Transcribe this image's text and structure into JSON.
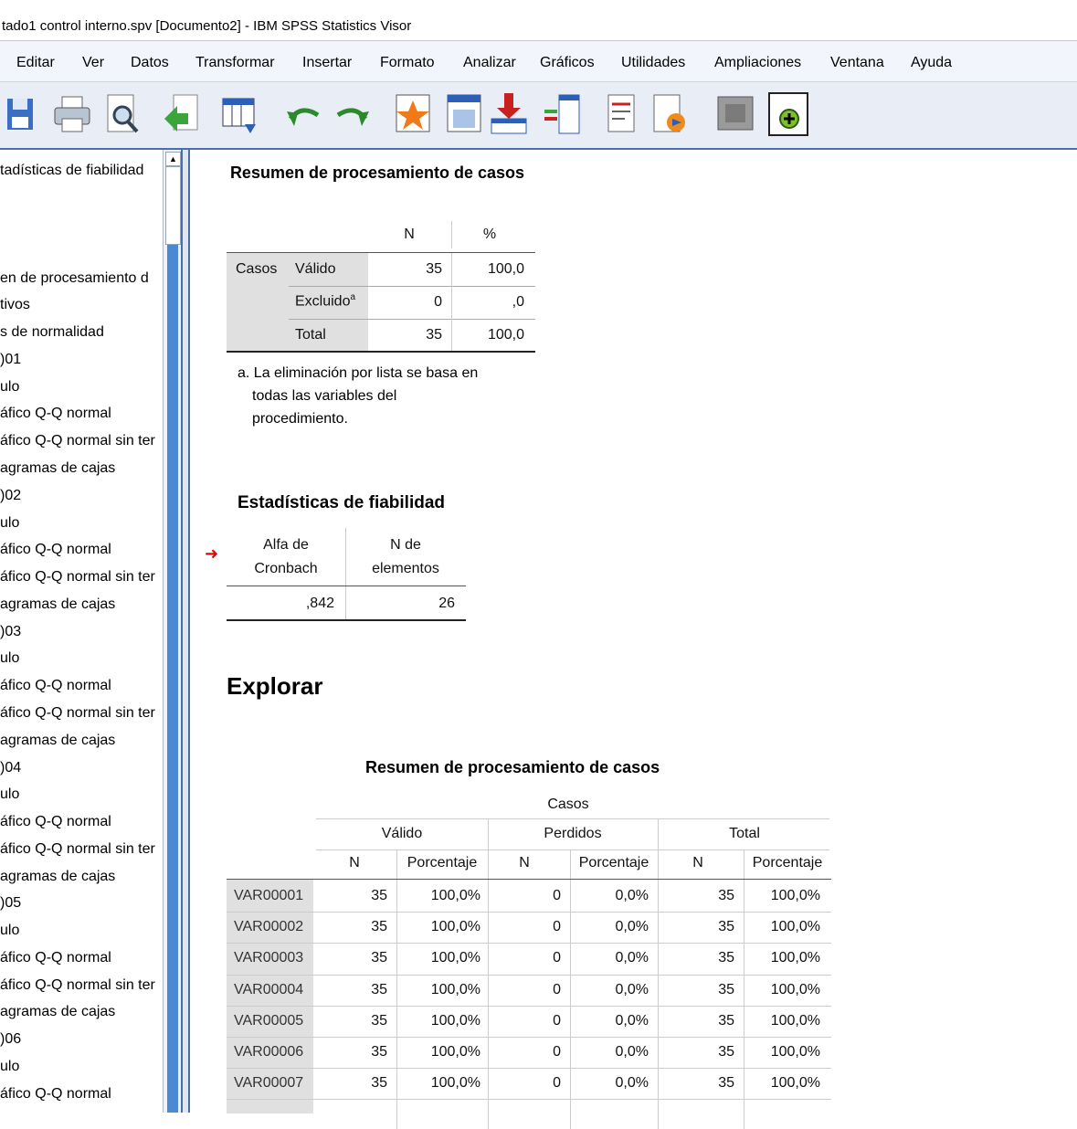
{
  "window": {
    "title": "tado1 control interno.spv [Documento2] - IBM SPSS Statistics Visor"
  },
  "menu": [
    "Editar",
    "Ver",
    "Datos",
    "Transformar",
    "Insertar",
    "Formato",
    "Analizar",
    "Gráficos",
    "Utilidades",
    "Ampliaciones",
    "Ventana",
    "Ayuda"
  ],
  "toolbar_icons": [
    "save-icon",
    "print-icon",
    "print-preview-icon",
    "export-icon",
    "goto-data-icon",
    "undo-icon",
    "redo-icon",
    "goto-case-icon",
    "goto-variable-icon",
    "insert-output-icon",
    "insert-table-icon",
    "insert-text-icon",
    "insert-chart-icon",
    "promote-icon",
    "designate-window-icon"
  ],
  "nav": [
    "tadísticas de fiabilidad",
    "en de procesamiento d",
    "tivos",
    "s de normalidad",
    ")01",
    "ulo",
    "áfico Q-Q normal",
    "áfico Q-Q normal sin ter",
    "agramas de cajas",
    ")02",
    "ulo",
    "áfico Q-Q normal",
    "áfico Q-Q normal sin ter",
    "agramas de cajas",
    ")03",
    "ulo",
    "áfico Q-Q normal",
    "áfico Q-Q normal sin ter",
    "agramas de cajas",
    ")04",
    "ulo",
    "áfico Q-Q normal",
    "áfico Q-Q normal sin ter",
    "agramas de cajas",
    ")05",
    "ulo",
    "áfico Q-Q normal",
    "áfico Q-Q normal sin ter",
    "agramas de cajas",
    ")06",
    "ulo",
    "áfico Q-Q normal"
  ],
  "case_summary": {
    "title": "Resumen de procesamiento de casos",
    "headers": [
      "N",
      "%"
    ],
    "group": "Casos",
    "rows": [
      {
        "label": "Válido",
        "n": "35",
        "pct": "100,0"
      },
      {
        "label": "Excluido",
        "sup": "a",
        "n": "0",
        "pct": ",0"
      },
      {
        "label": "Total",
        "n": "35",
        "pct": "100,0"
      }
    ],
    "footnote": [
      "a. La eliminación por lista se basa en",
      "todas las variables del",
      "procedimiento."
    ]
  },
  "reliability": {
    "title": "Estadísticas de fiabilidad",
    "col1": [
      "Alfa de",
      "Cronbach"
    ],
    "col2": [
      "N de",
      "elementos"
    ],
    "alpha": ",842",
    "n_items": "26"
  },
  "explore": {
    "heading": "Explorar",
    "title": "Resumen de procesamiento de casos",
    "group": "Casos",
    "subgroups": [
      "Válido",
      "Perdidos",
      "Total"
    ],
    "subheaders": [
      "N",
      "Porcentaje",
      "N",
      "Porcentaje",
      "N",
      "Porcentaje"
    ],
    "rows": [
      [
        "VAR00001",
        "35",
        "100,0%",
        "0",
        "0,0%",
        "35",
        "100,0%"
      ],
      [
        "VAR00002",
        "35",
        "100,0%",
        "0",
        "0,0%",
        "35",
        "100,0%"
      ],
      [
        "VAR00003",
        "35",
        "100,0%",
        "0",
        "0,0%",
        "35",
        "100,0%"
      ],
      [
        "VAR00004",
        "35",
        "100,0%",
        "0",
        "0,0%",
        "35",
        "100,0%"
      ],
      [
        "VAR00005",
        "35",
        "100,0%",
        "0",
        "0,0%",
        "35",
        "100,0%"
      ],
      [
        "VAR00006",
        "35",
        "100,0%",
        "0",
        "0,0%",
        "35",
        "100,0%"
      ],
      [
        "VAR00007",
        "35",
        "100,0%",
        "0",
        "0,0%",
        "35",
        "100,0%"
      ]
    ]
  }
}
